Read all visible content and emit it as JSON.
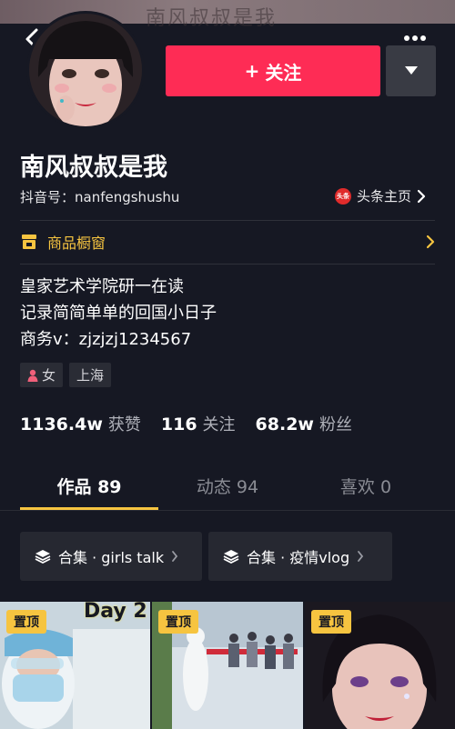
{
  "top_banner": {
    "ghost_text": "南风叔叔是我"
  },
  "profile": {
    "name": "南风叔叔是我",
    "douyin_id": "抖音号：nanfengshushu",
    "toutiao_link": "头条主页",
    "toutiao_logo_text": "头条"
  },
  "actions": {
    "follow_label": "关注",
    "follow_prefix": "+"
  },
  "shop": {
    "label": "商品橱窗"
  },
  "bio": {
    "lines": [
      "皇家艺术学院研一在读",
      "记录简简单单的回国小日子",
      "商务v：zjzjzj1234567"
    ]
  },
  "tags": [
    {
      "label": "女",
      "icon": "female-icon"
    },
    {
      "label": "上海",
      "icon": ""
    }
  ],
  "stats": [
    {
      "value": "1136.4w",
      "label": "获赞"
    },
    {
      "value": "116",
      "label": "关注"
    },
    {
      "value": "68.2w",
      "label": "粉丝"
    }
  ],
  "tabs": [
    {
      "label": "作品 89",
      "active": true
    },
    {
      "label": "动态 94",
      "active": false
    },
    {
      "label": "喜欢 0",
      "active": false
    }
  ],
  "collections": [
    {
      "label": "合集 · girls talk"
    },
    {
      "label": "合集 · 疫情vlog"
    }
  ],
  "videos": [
    {
      "badge": "置顶",
      "overlay": "Day 2"
    },
    {
      "badge": "置顶",
      "overlay": ""
    },
    {
      "badge": "置顶",
      "overlay": ""
    }
  ],
  "colors": {
    "accent_red": "#fe2c55",
    "accent_yellow": "#f6c440",
    "background": "#161823"
  }
}
